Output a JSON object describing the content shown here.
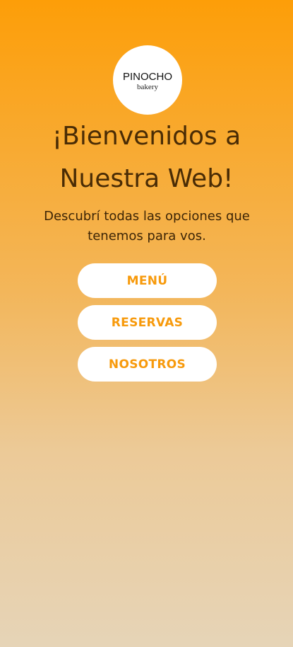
{
  "logo": {
    "name": "PINOCHO",
    "sub": "bakery"
  },
  "hero": {
    "title": "¡Bienvenidos a Nuestra Web!",
    "subtitle": "Descubrí todas las opciones que tenemos para vos."
  },
  "nav": {
    "menu_label": "MENÚ",
    "reservas_label": "RESERVAS",
    "nosotros_label": "NOSOTROS"
  },
  "colors": {
    "accent": "#f79a0c",
    "text_dark": "#4a2c05",
    "gradient_top": "#fd9e08",
    "gradient_bottom": "#e6d4b7"
  }
}
